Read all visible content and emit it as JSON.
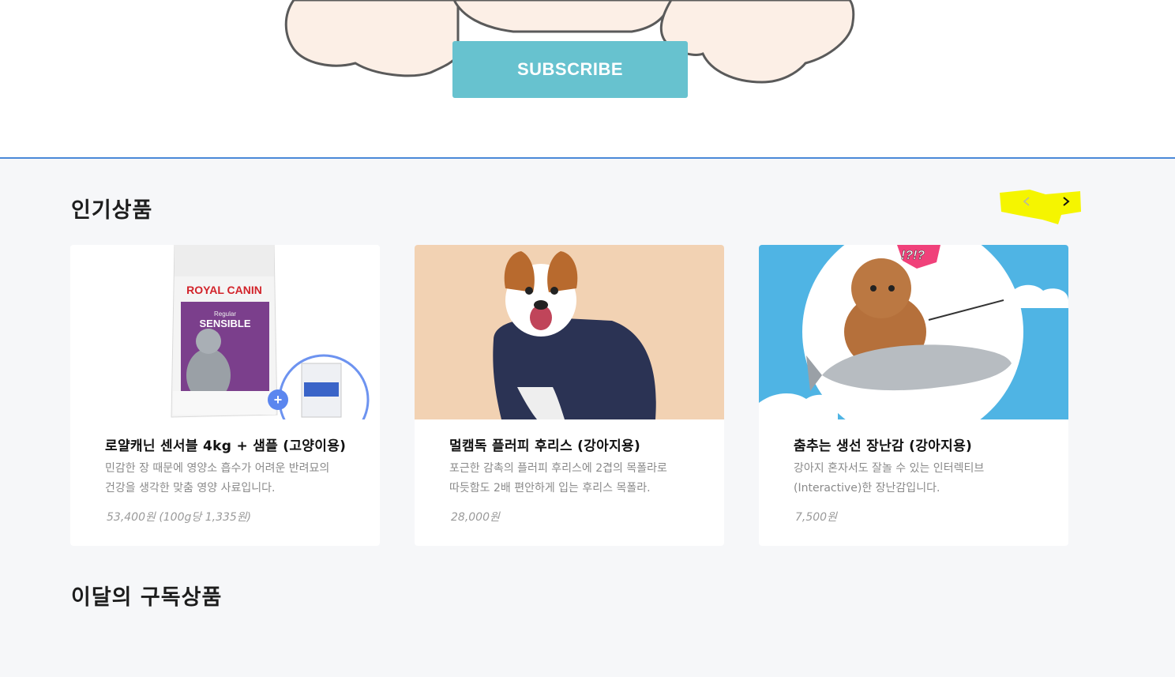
{
  "hero": {
    "subscribe_label": "SUBSCRIBE"
  },
  "popular": {
    "title": "인기상품",
    "nav": {
      "prev_icon": "chevron-left-icon",
      "next_icon": "chevron-right-icon"
    },
    "products": [
      {
        "name": "로얄캐닌 센서블 4kg + 샘플 (고양이용)",
        "description": "민감한 장 때문에 영양소 흡수가 어려운 반려묘의\n건강을 생각한 맞춤 영양 사료입니다.",
        "price": "53,400원 (100g당 1,335원)",
        "image": {
          "package_brand": "ROYAL CANIN",
          "package_line": "Regular",
          "package_name": "SENSIBLE"
        }
      },
      {
        "name": "멀캠독 플러피 후리스 (강아지용)",
        "description": "포근한 감촉의 플러피 후리스에 2겹의 목폴라로\n따듯함도 2배 편안하게 입는 후리스 목폴라.",
        "price": "28,000원"
      },
      {
        "name": "춤추는 생선 장난감 (강아지용)",
        "description": "강아지 혼자서도 잘놀 수 있는 인터렉티브\n(Interactive)한 장난감입니다.",
        "price": "7,500원",
        "image": {
          "badge_text": "!?!?"
        }
      }
    ]
  },
  "monthly": {
    "title": "이달의 구독상품"
  },
  "colors": {
    "subscribe_button": "#67c2cf",
    "divider": "#4a89d8",
    "section_background": "#f6f7f9",
    "nav_highlight": "#f5f500",
    "card_background": "#ffffff"
  }
}
